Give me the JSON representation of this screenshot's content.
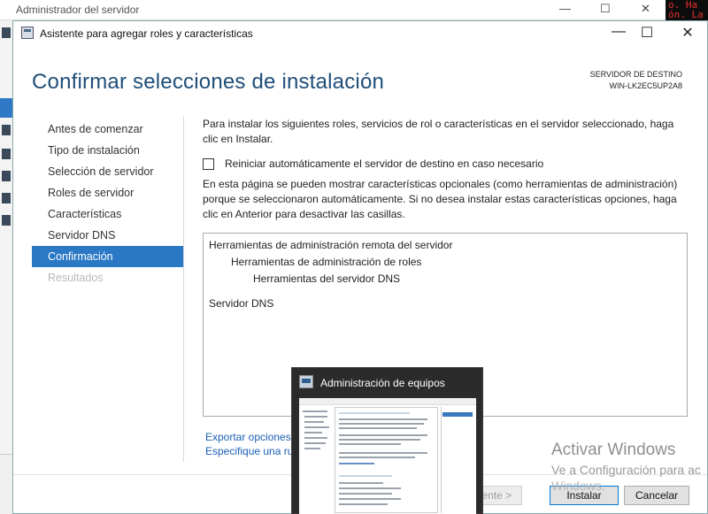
{
  "background_window": {
    "title": "Administrador del servidor",
    "terminal_text": [
      "o. Ha",
      "ón. La"
    ]
  },
  "wizard": {
    "title": "Asistente para agregar roles y características",
    "heading": "Confirmar selecciones de instalación",
    "destination_label": "SERVIDOR DE DESTINO",
    "destination_server": "WIN-LK2EC5UP2A8",
    "nav": [
      {
        "label": "Antes de comenzar",
        "state": "normal"
      },
      {
        "label": "Tipo de instalación",
        "state": "normal"
      },
      {
        "label": "Selección de servidor",
        "state": "normal"
      },
      {
        "label": "Roles de servidor",
        "state": "normal"
      },
      {
        "label": "Características",
        "state": "normal"
      },
      {
        "label": "Servidor DNS",
        "state": "normal"
      },
      {
        "label": "Confirmación",
        "state": "active"
      },
      {
        "label": "Resultados",
        "state": "disabled"
      }
    ],
    "intro_text": "Para instalar los siguientes roles, servicios de rol o características en el servidor seleccionado, haga clic en Instalar.",
    "restart_checkbox_label": "Reiniciar automáticamente el servidor de destino en caso necesario",
    "restart_checked": false,
    "optional_text": "En esta página se pueden mostrar características opcionales (como herramientas de administración) porque se seleccionaron automáticamente. Si no desea instalar estas características opciones, haga clic en Anterior para desactivar las casillas.",
    "selections": [
      {
        "label": "Herramientas de administración remota del servidor",
        "level": 0
      },
      {
        "label": "Herramientas de administración de roles",
        "level": 1
      },
      {
        "label": "Herramientas del servidor DNS",
        "level": 2
      },
      {
        "label": "Servidor DNS",
        "level": 0
      }
    ],
    "links": {
      "export": "Exportar opciones d",
      "alternate": "Especifique una ru"
    },
    "buttons": {
      "next": "iente >",
      "install": "Instalar",
      "cancel": "Cancelar"
    }
  },
  "thumbnail": {
    "title": "Administración de equipos"
  },
  "watermark": {
    "title": "Activar Windows",
    "subtitle": "Ve a Configuración para ac",
    "subtitle2": "Windows."
  },
  "colors": {
    "accent": "#2b78c5",
    "heading": "#1f4e79",
    "link": "#1a5fb4"
  }
}
